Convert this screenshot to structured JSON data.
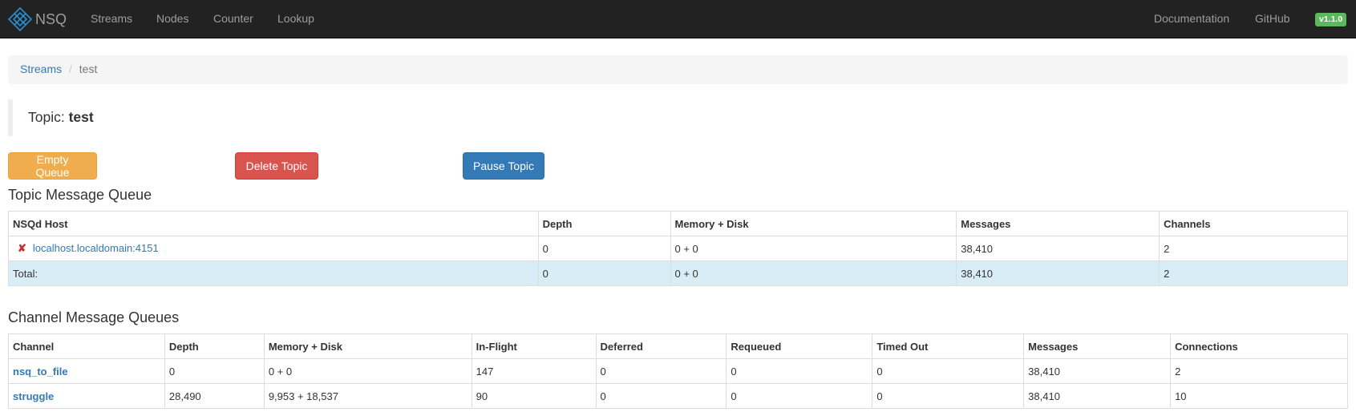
{
  "navbar": {
    "brand": "NSQ",
    "links": [
      "Streams",
      "Nodes",
      "Counter",
      "Lookup"
    ],
    "right_links": [
      "Documentation",
      "GitHub"
    ],
    "version": "v1.1.0"
  },
  "breadcrumb": {
    "root": "Streams",
    "separator": "/",
    "current": "test"
  },
  "topic": {
    "label": "Topic:",
    "name": "test"
  },
  "actions": {
    "empty_queue": "Empty Queue",
    "delete_topic": "Delete Topic",
    "pause_topic": "Pause Topic"
  },
  "topic_queue": {
    "title": "Topic Message Queue",
    "headers": [
      "NSQd Host",
      "Depth",
      "Memory + Disk",
      "Messages",
      "Channels"
    ],
    "rows": [
      {
        "host": "localhost.localdomain:4151",
        "depth": "0",
        "memory_disk": "0 + 0",
        "messages": "38,410",
        "channels": "2"
      }
    ],
    "total": {
      "label": "Total:",
      "depth": "0",
      "memory_disk": "0 + 0",
      "messages": "38,410",
      "channels": "2"
    }
  },
  "channel_queues": {
    "title": "Channel Message Queues",
    "headers": [
      "Channel",
      "Depth",
      "Memory + Disk",
      "In-Flight",
      "Deferred",
      "Requeued",
      "Timed Out",
      "Messages",
      "Connections"
    ],
    "rows": [
      {
        "channel": "nsq_to_file",
        "depth": "0",
        "memory_disk": "0 + 0",
        "in_flight": "147",
        "deferred": "0",
        "requeued": "0",
        "timed_out": "0",
        "messages": "38,410",
        "connections": "2"
      },
      {
        "channel": "struggle",
        "depth": "28,490",
        "memory_disk": "9,953 + 18,537",
        "in_flight": "90",
        "deferred": "0",
        "requeued": "0",
        "timed_out": "0",
        "messages": "38,410",
        "connections": "10"
      }
    ]
  },
  "colors": {
    "navbar_bg": "#222222",
    "link": "#337ab7",
    "warning": "#f0ad4e",
    "danger": "#d9534f",
    "primary": "#337ab7",
    "badge": "#5cb85c",
    "total_row": "#d9edf7"
  },
  "icons": {
    "brand": "nsq-logo-icon",
    "host_status": "cross-icon"
  }
}
